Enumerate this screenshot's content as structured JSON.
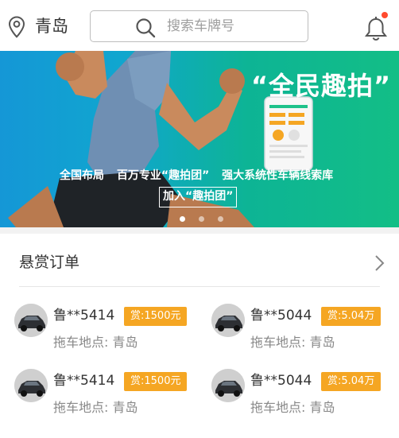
{
  "header": {
    "city": "青岛",
    "search_placeholder": "搜索车牌号",
    "icons": [
      "location-pin-icon",
      "search-icon",
      "bell-icon"
    ],
    "notification_dot_color": "#ff4a2e"
  },
  "banner": {
    "title": "“全民趣拍”",
    "subtitle_items": [
      "全国布局",
      "百万专业“趣拍团”",
      "强大系统性车辆线索库"
    ],
    "join_label": "加入“趣拍团”",
    "slide_count": 3,
    "active_slide": 0,
    "gradient_colors": [
      "#1597d6",
      "#13be86"
    ]
  },
  "reward_section": {
    "title": "悬赏订单",
    "orders": [
      {
        "plate": "鲁**5414",
        "reward": "赏:1500元",
        "address_label": "拖车地点:",
        "address": "青岛"
      },
      {
        "plate": "鲁**5044",
        "reward": "赏:5.04万",
        "address_label": "拖车地点:",
        "address": "青岛"
      },
      {
        "plate": "鲁**5414",
        "reward": "赏:1500元",
        "address_label": "拖车地点:",
        "address": "青岛"
      },
      {
        "plate": "鲁**5044",
        "reward": "赏:5.04万",
        "address_label": "拖车地点:",
        "address": "青岛"
      }
    ],
    "badge_color": "#f5a623"
  }
}
